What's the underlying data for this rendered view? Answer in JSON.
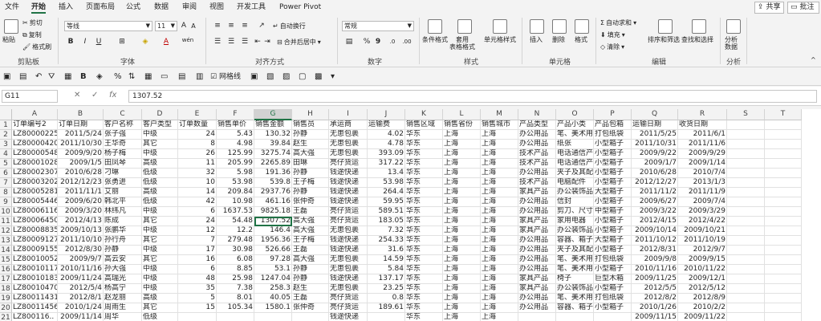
{
  "tabs": [
    "文件",
    "开始",
    "插入",
    "页面布局",
    "公式",
    "数据",
    "审阅",
    "视图",
    "开发工具",
    "Power Pivot"
  ],
  "active_tab": "开始",
  "share_label": "共享",
  "comment_label": "批注",
  "ribbon": {
    "clipboard": {
      "paste": "粘贴",
      "cut": "剪切",
      "copy": "复制",
      "format_painter": "格式刷",
      "label": "剪贴板"
    },
    "font": {
      "name": "等线",
      "size": "11",
      "bold": "B",
      "italic": "I",
      "underline": "U",
      "grow": "A",
      "shrink": "A",
      "label": "字体",
      "wen": "wén"
    },
    "alignment": {
      "wrap": "自动换行",
      "merge": "合并后居中",
      "label": "对齐方式"
    },
    "number": {
      "format": "常规",
      "label": "数字"
    },
    "styles": {
      "conditional": "条件格式",
      "table": "套用\n表格格式",
      "cell_styles": "单元格样式",
      "label": "样式"
    },
    "cells": {
      "insert": "插入",
      "delete": "删除",
      "format": "格式",
      "label": "单元格"
    },
    "editing": {
      "autosum": "自动求和",
      "fill": "填充",
      "clear": "清除",
      "sort": "排序和筛选",
      "find": "查找和选择",
      "label": "编辑"
    },
    "analysis": {
      "analyze": "分析\n数据",
      "label": "分析"
    }
  },
  "quickbar": {
    "gridlines": "网格线"
  },
  "formula_bar": {
    "name_box": "G11",
    "value": "1307.52",
    "fx": "fx"
  },
  "columns": [
    "A",
    "B",
    "C",
    "D",
    "E",
    "F",
    "G",
    "H",
    "I",
    "J",
    "K",
    "L",
    "M",
    "N",
    "O",
    "P",
    "Q",
    "R",
    "S",
    "T"
  ],
  "selected_column": "G",
  "header_row": [
    "订单编号2",
    "订单日期",
    "客户名称",
    "客户类型",
    "订单数量",
    "销售单价",
    "销售金额",
    "销售员",
    "承运商",
    "运输费",
    "销售区域",
    "销售省份",
    "销售城市",
    "产品类型",
    "产品小类",
    "产品包箱",
    "运输日期",
    "收货日期",
    "",
    ""
  ],
  "rows": [
    [
      "LZ80000225",
      "2011/5/24",
      "张子强",
      "中级",
      "24",
      "5.43",
      "130.32",
      "孙静",
      "无患包裹",
      "4.02",
      "华东",
      "上海",
      "上海",
      "办公用品",
      "笔、美术用",
      "打包纸袋",
      "2011/5/25",
      "2011/6/1",
      "",
      ""
    ],
    [
      "LZ80000420",
      "2011/10/30",
      "王华奇",
      "其它",
      "8",
      "4.98",
      "39.84",
      "赵生",
      "无患包裹",
      "4.78",
      "华东",
      "上海",
      "上海",
      "办公用品",
      "纸张",
      "小型箱子",
      "2011/10/31",
      "2011/11/6",
      "",
      ""
    ],
    [
      "LZ80000548",
      "2009/9/20",
      "杨子梅",
      "中级",
      "26",
      "125.99",
      "3275.74",
      "高大强",
      "无患包裹",
      "393.09",
      "华东",
      "上海",
      "上海",
      "技术产品",
      "电话通信产",
      "小型箱子",
      "2009/9/22",
      "2009/9/29",
      "",
      ""
    ],
    [
      "LZ80001028",
      "2009/1/5",
      "田凤琴",
      "高级",
      "11",
      "205.99",
      "2265.89",
      "田琳",
      "亮仔货运",
      "317.22",
      "华东",
      "上海",
      "上海",
      "技术产品",
      "电话通信产",
      "小型箱子",
      "2009/1/7",
      "2009/1/14",
      "",
      ""
    ],
    [
      "LZ80002307",
      "2010/6/28",
      "刁琳",
      "低级",
      "32",
      "5.98",
      "191.36",
      "孙静",
      "钱途快递",
      "13.4",
      "华东",
      "上海",
      "上海",
      "办公用品",
      "夹子及其配",
      "小型箱子",
      "2010/6/28",
      "2010/7/4",
      "",
      ""
    ],
    [
      "LZ80003202",
      "2012/12/23",
      "张勇进",
      "低级",
      "10",
      "53.98",
      "539.8",
      "王子梅",
      "钱途快递",
      "53.98",
      "华东",
      "上海",
      "上海",
      "技术产品",
      "电脑配件",
      "小型箱子",
      "2012/12/27",
      "2013/1/3",
      "",
      ""
    ],
    [
      "LZ80005281",
      "2011/11/1",
      "艾丽",
      "高级",
      "14",
      "209.84",
      "2937.76",
      "孙静",
      "钱途快递",
      "264.4",
      "华东",
      "上海",
      "上海",
      "家具产品",
      "办公装饰品",
      "大型箱子",
      "2011/11/2",
      "2011/11/9",
      "",
      ""
    ],
    [
      "LZ80005446",
      "2009/6/20",
      "韩北平",
      "低级",
      "42",
      "10.98",
      "461.16",
      "张仲奇",
      "钱途快递",
      "59.95",
      "华东",
      "上海",
      "上海",
      "办公用品",
      "信封",
      "小型箱子",
      "2009/6/27",
      "2009/7/4",
      "",
      ""
    ],
    [
      "LZ80006116",
      "2009/3/20",
      "林纬凡",
      "中级",
      "6",
      "1637.53",
      "9825.18",
      "王磊",
      "亮仔货运",
      "589.51",
      "华东",
      "上海",
      "上海",
      "办公用品",
      "剪刀、尺寸",
      "中型箱子",
      "2009/3/22",
      "2009/3/29",
      "",
      ""
    ],
    [
      "LZ80006450",
      "2012/4/13",
      "陈成",
      "其它",
      "24",
      "54.48",
      "1307.52",
      "高大强",
      "亮仔货运",
      "183.05",
      "华东",
      "上海",
      "上海",
      "家具产品",
      "家用电器",
      "小型箱子",
      "2012/4/15",
      "2012/4/22",
      "",
      ""
    ],
    [
      "LZ80008835",
      "2009/10/13",
      "张鹏华",
      "中级",
      "12",
      "12.2",
      "146.4",
      "高大强",
      "无患包裹",
      "7.32",
      "华东",
      "上海",
      "上海",
      "家具产品",
      "办公装饰品",
      "小型箱子",
      "2009/10/14",
      "2009/10/21",
      "",
      ""
    ],
    [
      "LZ80009127",
      "2011/10/10",
      "孙行舟",
      "其它",
      "7",
      "279.48",
      "1956.36",
      "王子梅",
      "钱途快递",
      "254.33",
      "华东",
      "上海",
      "上海",
      "办公用品",
      "容器、箱子",
      "大型箱子",
      "2011/10/12",
      "2011/10/19",
      "",
      ""
    ],
    [
      "LZ80009155",
      "2012/8/30",
      "孙静",
      "中级",
      "17",
      "30.98",
      "526.66",
      "王磊",
      "钱途快递",
      "31.6",
      "华东",
      "上海",
      "上海",
      "办公用品",
      "夹子及其配",
      "小型箱子",
      "2012/8/31",
      "2012/9/7",
      "",
      ""
    ],
    [
      "LZ80010052",
      "2009/9/7",
      "高云安",
      "其它",
      "16",
      "6.08",
      "97.28",
      "高大强",
      "无患包裹",
      "14.59",
      "华东",
      "上海",
      "上海",
      "办公用品",
      "笔、美术用",
      "打包纸袋",
      "2009/9/8",
      "2009/9/15",
      "",
      ""
    ],
    [
      "LZ80010117",
      "2010/11/16",
      "孙大强",
      "中级",
      "6",
      "8.85",
      "53.1",
      "孙静",
      "无患包裹",
      "5.84",
      "华东",
      "上海",
      "上海",
      "办公用品",
      "笔、美术用",
      "小型箱子",
      "2010/11/16",
      "2010/11/22",
      "",
      ""
    ],
    [
      "LZ80010183",
      "2009/11/24",
      "高瑞光",
      "中级",
      "48",
      "25.98",
      "1247.04",
      "孙静",
      "钱途快递",
      "137.17",
      "华东",
      "上海",
      "上海",
      "家具产品",
      "椅子",
      "巨型木箱",
      "2009/11/25",
      "2009/12/1",
      "",
      ""
    ],
    [
      "LZ80010470",
      "2012/5/4",
      "杨高宁",
      "中级",
      "35",
      "7.38",
      "258.3",
      "赵生",
      "无患包裹",
      "23.25",
      "华东",
      "上海",
      "上海",
      "家具产品",
      "办公装饰品",
      "小型箱子",
      "2012/5/5",
      "2012/5/12",
      "",
      ""
    ],
    [
      "LZ80011431",
      "2012/8/1",
      "赵龙丽",
      "高级",
      "5",
      "8.01",
      "40.05",
      "王磊",
      "亮仔货运",
      "0.8",
      "华东",
      "上海",
      "上海",
      "办公用品",
      "笔、美术用",
      "打包纸袋",
      "2012/8/2",
      "2012/8/9",
      "",
      ""
    ],
    [
      "LZ80011456",
      "2010/1/24",
      "周雨生",
      "其它",
      "15",
      "105.34",
      "1580.1",
      "张仲奇",
      "亮仔货运",
      "189.61",
      "华东",
      "上海",
      "上海",
      "办公用品",
      "容器、箱子",
      "小型箱子",
      "2010/1/26",
      "2010/2/2",
      "",
      ""
    ]
  ],
  "partial_row": [
    "LZ800116..",
    "2009/11/14",
    "周华",
    "低级",
    "",
    "",
    "",
    "",
    "钱途快递",
    "",
    "华东",
    "上海",
    "上海",
    "",
    "",
    "",
    "2009/11/15",
    "2009/11/22",
    "",
    ""
  ]
}
